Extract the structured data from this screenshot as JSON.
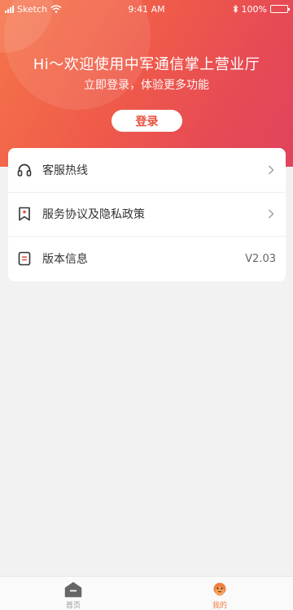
{
  "status_bar": {
    "carrier": "Sketch",
    "time": "9:41 AM",
    "battery": "100%"
  },
  "header": {
    "greeting": "Hi～欢迎使用中军通信掌上营业厅",
    "subtitle": "立即登录，体验更多功能",
    "login_label": "登录"
  },
  "menu": {
    "items": [
      {
        "label": "客服热线",
        "icon": "headset-icon"
      },
      {
        "label": "服务协议及隐私政策",
        "icon": "bookmark-icon"
      },
      {
        "label": "版本信息",
        "icon": "document-icon",
        "value": "V2.03"
      }
    ]
  },
  "tabbar": {
    "tabs": [
      {
        "label": "首页",
        "icon": "home-icon"
      },
      {
        "label": "我的",
        "icon": "profile-icon"
      }
    ]
  },
  "colors": {
    "accent": "#e8503d",
    "icon_red": "#e24d3d",
    "tab_active": "#f08040",
    "tab_inactive": "#666666"
  }
}
